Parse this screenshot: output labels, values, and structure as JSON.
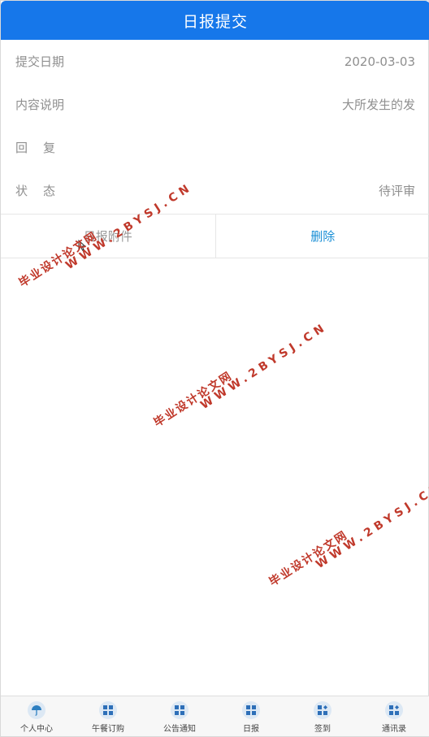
{
  "header": {
    "title": "日报提交"
  },
  "form": {
    "rows": [
      {
        "label": "提交日期",
        "value": "2020-03-03"
      },
      {
        "label": "内容说明",
        "value": "大所发生的发"
      },
      {
        "label": "回复",
        "value": ""
      },
      {
        "label": "状态",
        "value": "待评审"
      }
    ]
  },
  "actions": {
    "attachment_label": "日报附件",
    "delete_label": "删除"
  },
  "tabbar": {
    "items": [
      {
        "label": "个人中心",
        "icon": "umbrella-icon"
      },
      {
        "label": "午餐订购",
        "icon": "grid-icon"
      },
      {
        "label": "公告通知",
        "icon": "grid-icon"
      },
      {
        "label": "日报",
        "icon": "grid-icon"
      },
      {
        "label": "签到",
        "icon": "grid-plus-icon"
      },
      {
        "label": "通讯录",
        "icon": "grid-plus-icon"
      }
    ]
  },
  "watermark": {
    "cn": "毕业设计论文网",
    "en": "WWW.2BYSJ.CN"
  },
  "colors": {
    "header": "#1677ea",
    "link": "#1a8fd6",
    "watermark": "#c0392b"
  }
}
